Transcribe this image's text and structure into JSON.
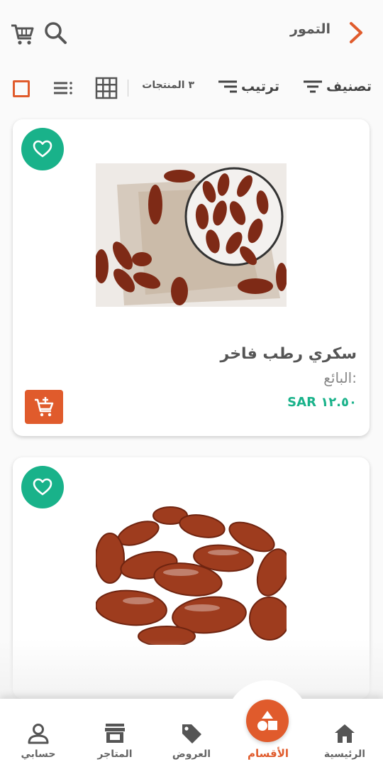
{
  "header": {
    "title": "التمور",
    "back_icon": "chevron-right-icon",
    "search_icon": "search-icon",
    "cart_icon": "cart-icon"
  },
  "toolbar": {
    "filter_label": "تصنيف",
    "sort_label": "ترتيب",
    "product_count": "٣ المنتجات"
  },
  "products": [
    {
      "name": "سكري رطب فاخر",
      "seller_label": "البائع:",
      "price": "SAR ١٢.٥٠"
    },
    {
      "name": "",
      "seller_label": "",
      "price": ""
    }
  ],
  "bottom_nav": {
    "items": [
      {
        "label": "الرئيسية",
        "icon": "home-icon"
      },
      {
        "label": "الأقسام",
        "icon": "categories-icon",
        "active": true
      },
      {
        "label": "العروض",
        "icon": "tag-icon"
      },
      {
        "label": "المتاجر",
        "icon": "store-icon"
      },
      {
        "label": "حسابي",
        "icon": "user-icon"
      }
    ]
  },
  "colors": {
    "accent": "#e05b2c",
    "favorite": "#19b28a",
    "price": "#19b28a"
  }
}
